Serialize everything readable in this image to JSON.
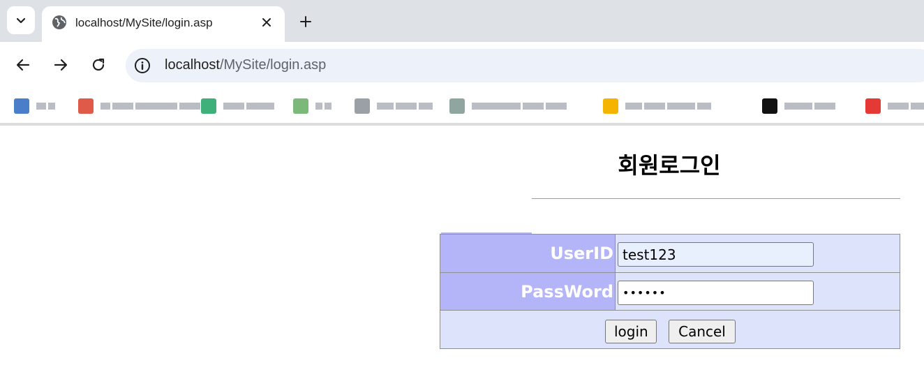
{
  "browser": {
    "tab": {
      "title": "localhost/MySite/login.asp"
    },
    "address": {
      "host": "localhost",
      "path": "/MySite/login.asp"
    },
    "bookmarks": [
      {
        "icon_color": "#4a7ec8",
        "label_blocks": [
          14,
          10
        ]
      },
      {
        "icon_color": "#e05a4a",
        "label_blocks": [
          14,
          30,
          60,
          30
        ]
      },
      {
        "icon_color": "#3fb07a",
        "label_blocks": [
          30,
          40
        ]
      },
      {
        "icon_color": "#7cb87a",
        "label_blocks": [
          10,
          10
        ]
      },
      {
        "icon_color": "#9aa0a6",
        "label_blocks": [
          24,
          30,
          20
        ]
      },
      {
        "icon_color": "#8fa6a0",
        "label_blocks": [
          70,
          30,
          30
        ]
      },
      {
        "icon_color": "#f4b400",
        "label_blocks": [
          24,
          30,
          40,
          20
        ]
      },
      {
        "icon_color": "#111111",
        "label_blocks": [
          40,
          30
        ]
      },
      {
        "icon_color": "#e53935",
        "label_blocks": [
          30,
          30
        ]
      }
    ]
  },
  "page": {
    "title": "회원로그인",
    "form": {
      "userid_label": "UserID",
      "userid_value": "test123",
      "password_label": "PassWord",
      "password_value": "••••••",
      "login_button": "login",
      "cancel_button": "Cancel"
    }
  },
  "colors": {
    "label_cell_bg": "#b4b4f8",
    "table_bg": "#dce3fb",
    "autofill_bg": "#e8f0fe"
  }
}
